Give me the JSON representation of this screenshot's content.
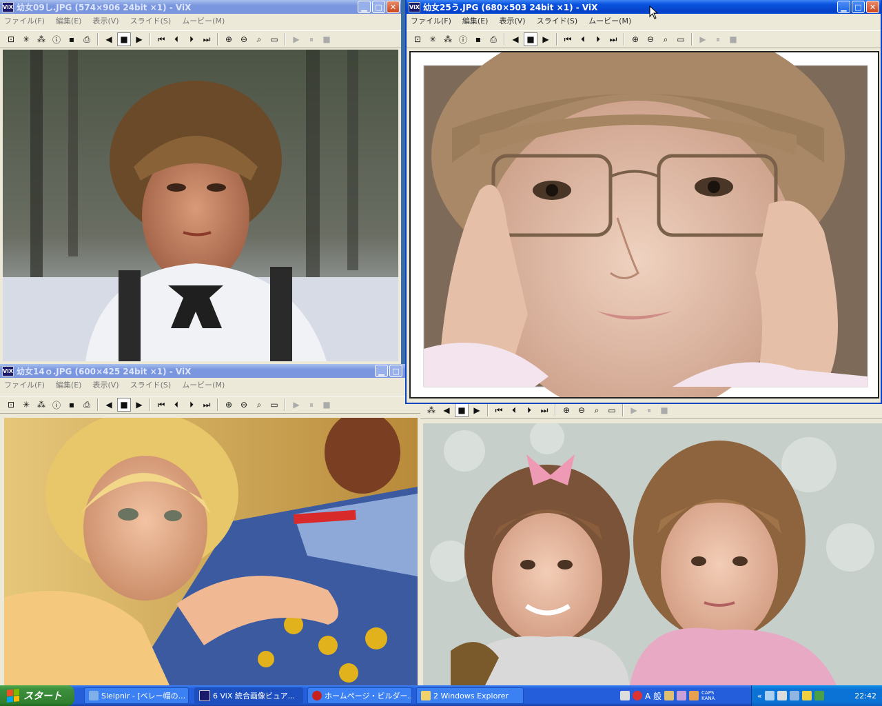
{
  "windows": {
    "w1": {
      "title": "幼女09し.JPG (574×906 24bit ×1) - ViX"
    },
    "w2": {
      "title": "幼女25う.JPG (680×503 24bit ×1) - ViX"
    },
    "w3": {
      "title": "幼女14ｏ.JPG (600×425 24bit ×1) - ViX"
    }
  },
  "menu": {
    "file": "ファイル(F)",
    "edit": "編集(E)",
    "view": "表示(V)",
    "slide": "スライド(S)",
    "movie": "ムービー(M)"
  },
  "icons": {
    "app": "ViX"
  },
  "taskbar": {
    "start_label": "スタート",
    "tasks": [
      {
        "label": "Sleipnir - [ベレー帽の..."
      },
      {
        "label": "6 ViX 統合画像ビュア..."
      },
      {
        "label": "ホームページ・ビルダー..."
      },
      {
        "label": "2 Windows Explorer"
      }
    ],
    "ime_mode": "A 般",
    "caps": "CAPS",
    "kana": "KANA",
    "clock": "22:42"
  }
}
